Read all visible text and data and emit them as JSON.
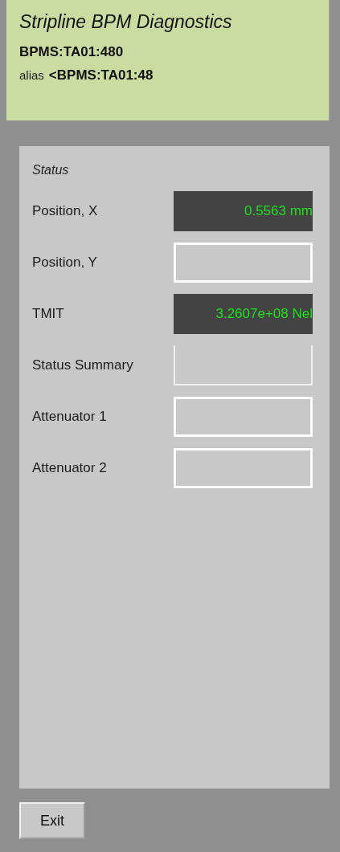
{
  "header": {
    "title": "Stripline BPM Diagnostics",
    "device": "BPMS:TA01:480",
    "alias_label": "alias",
    "alias": "<BPMS:TA01:48"
  },
  "status_panel": {
    "title": "Status",
    "rows": [
      {
        "label": "Position, X",
        "kind": "readout",
        "value": "0.5563 mm"
      },
      {
        "label": "Position, Y",
        "kind": "empty"
      },
      {
        "label": "TMIT",
        "kind": "readout",
        "value": "3.2607e+08 Nel"
      },
      {
        "label": "Status Summary",
        "kind": "blank"
      },
      {
        "label": "Attenuator 1",
        "kind": "empty"
      },
      {
        "label": "Attenuator 2",
        "kind": "empty"
      }
    ]
  },
  "buttons": [
    "Exit"
  ]
}
